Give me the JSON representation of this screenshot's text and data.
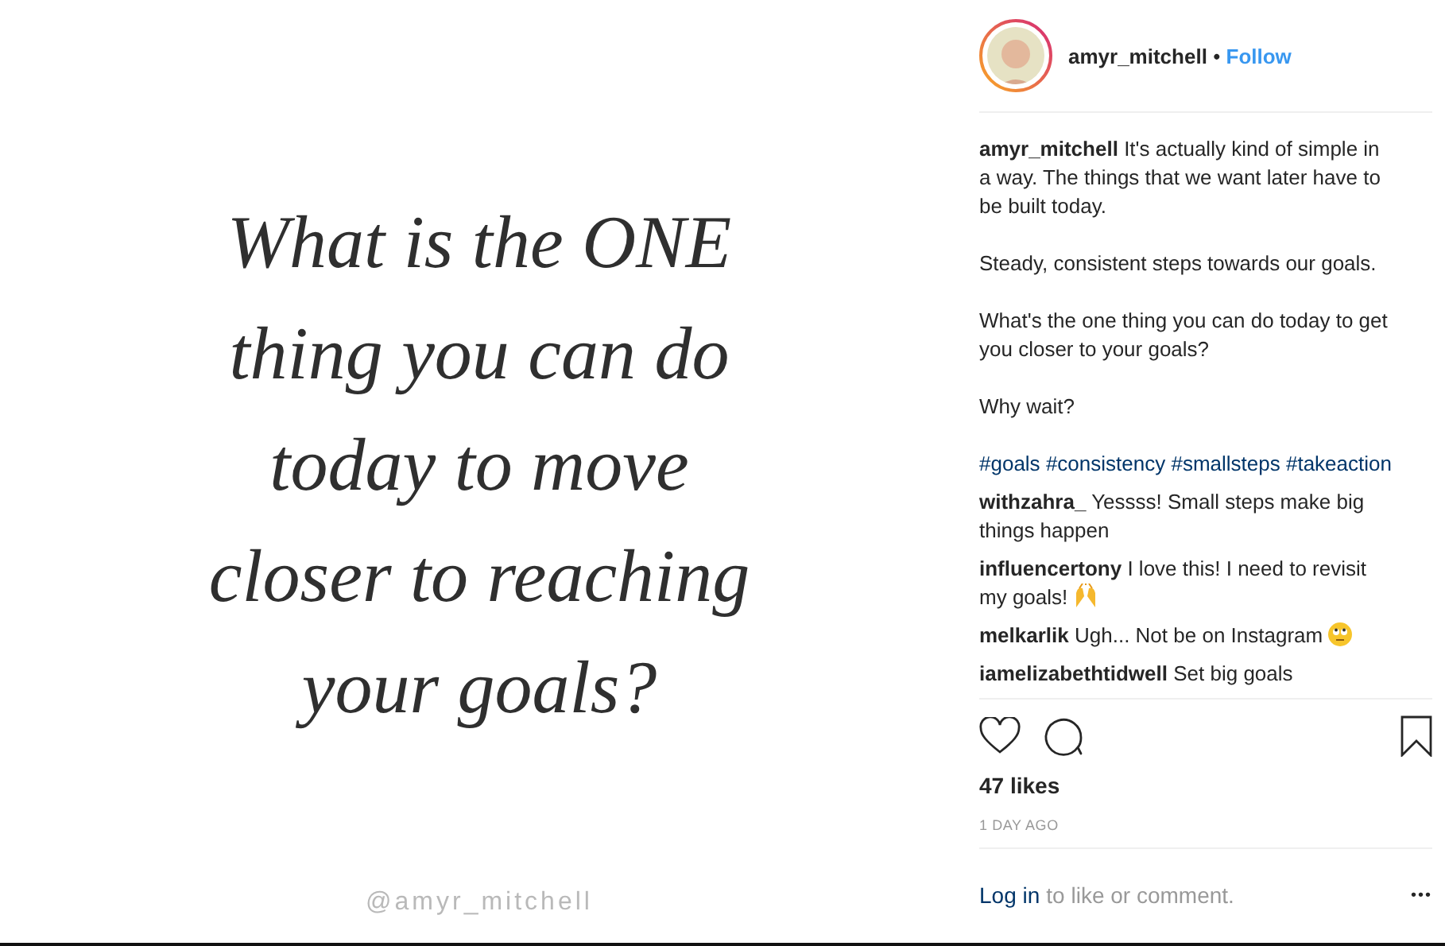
{
  "post_image": {
    "quote_lines": [
      "What is the ONE",
      "thing you can do",
      "today to move",
      "closer to reaching",
      "your goals?"
    ],
    "handle": "@amyr_mitchell"
  },
  "header": {
    "username": "amyr_mitchell",
    "separator": "•",
    "follow": "Follow"
  },
  "caption": {
    "username": "amyr_mitchell",
    "paragraphs": [
      "It's actually kind of simple in a way. The things that we want later have to be built today.",
      "Steady, consistent steps towards our goals.",
      "What's the one thing you can do today to get you closer to your goals?",
      "Why wait?"
    ],
    "hashtags": [
      "#goals",
      "#consistency",
      "#smallsteps",
      "#takeaction"
    ]
  },
  "comments": [
    {
      "username": "withzahra_",
      "text": "Yessss! Small steps make big things happen"
    },
    {
      "username": "influencertony",
      "text": "I love this! I need to revisit my goals!",
      "kind": "hands"
    },
    {
      "username": "melkarlik",
      "text": "Ugh... Not be on Instagram",
      "kind": "eyeroll"
    },
    {
      "username": "iamelizabethtidwell",
      "text": "Set big goals"
    }
  ],
  "likes": "47 likes",
  "time": "1 DAY AGO",
  "footer": {
    "login": "Log in",
    "rest": "to like or comment.",
    "more": "•••"
  }
}
